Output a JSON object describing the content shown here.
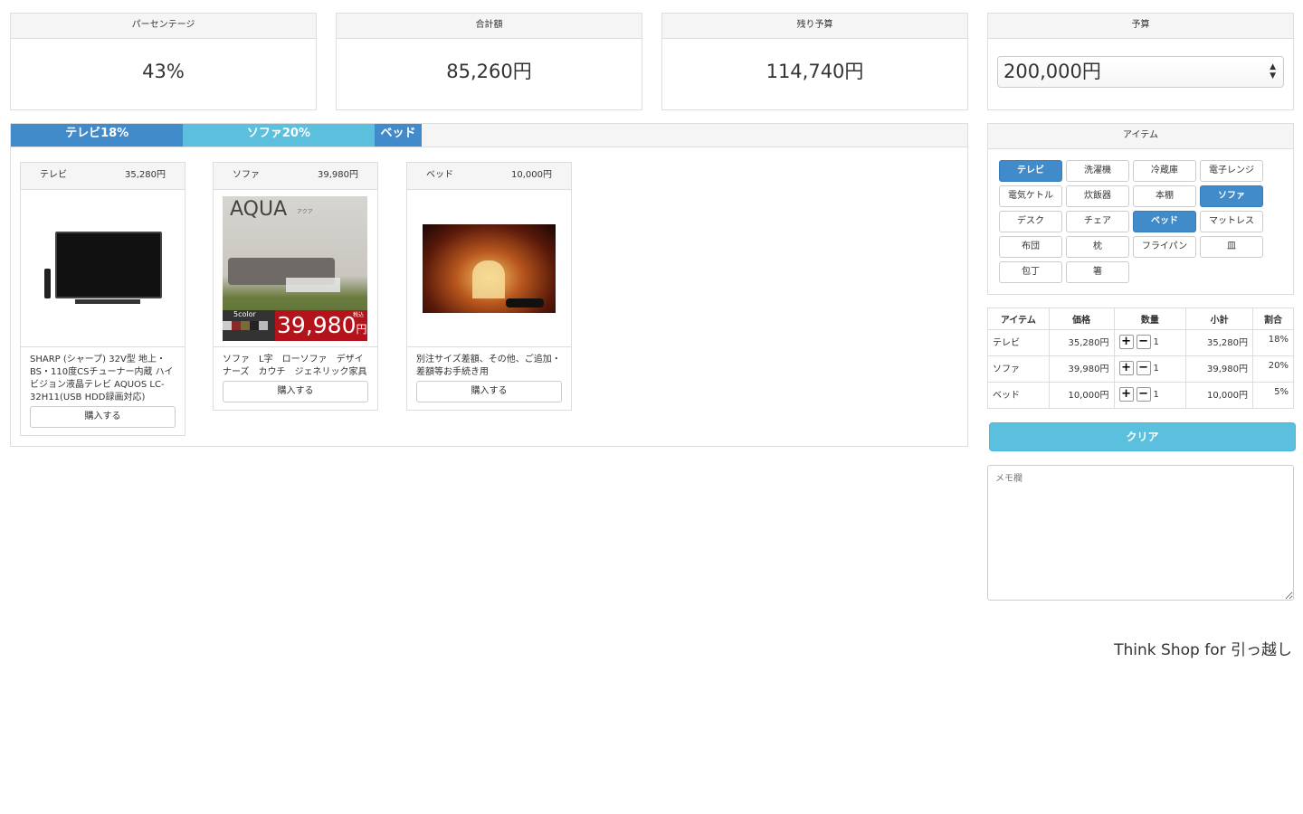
{
  "stats": [
    {
      "label": "パーセンテージ",
      "value": "43%"
    },
    {
      "label": "合計額",
      "value": "85,260円"
    },
    {
      "label": "残り予算",
      "value": "114,740円"
    }
  ],
  "budget": {
    "label": "予算",
    "value": "200,000円"
  },
  "progress": [
    {
      "label": "テレビ18%",
      "percent": 18,
      "color": "#428bca"
    },
    {
      "label": "ソファ20%",
      "percent": 20,
      "color": "#5bc0de"
    },
    {
      "label": "ベッド",
      "percent": 5,
      "color": "#428bca"
    }
  ],
  "cards": [
    {
      "name": "テレビ",
      "price": "35,280円",
      "desc": "SHARP (シャープ) 32V型 地上・BS・110度CSチューナー内蔵 ハイビジョン液晶テレビ AQUOS LC-32H11(USB HDD録画対応)",
      "buy": "購入する"
    },
    {
      "name": "ソファ",
      "price": "39,980円",
      "desc": "ソファ　L字　ローソファ　デザイナーズ　カウチ　ジェネリック家具",
      "buy": "購入する",
      "img_title": "AQUA",
      "img_sub": "アクア",
      "img_color": "5color",
      "img_price": "39,980",
      "img_yen": "円",
      "img_tax": "税込"
    },
    {
      "name": "ベッド",
      "price": "10,000円",
      "desc": "別注サイズ差額、その他、ご追加・差額等お手続き用",
      "buy": "購入する"
    }
  ],
  "items_panel": {
    "title": "アイテム",
    "items": [
      {
        "label": "テレビ",
        "on": true
      },
      {
        "label": "洗濯機",
        "on": false
      },
      {
        "label": "冷蔵庫",
        "on": false
      },
      {
        "label": "電子レンジ",
        "on": false
      },
      {
        "label": "電気ケトル",
        "on": false
      },
      {
        "label": "炊飯器",
        "on": false
      },
      {
        "label": "本棚",
        "on": false
      },
      {
        "label": "ソファ",
        "on": true
      },
      {
        "label": "デスク",
        "on": false
      },
      {
        "label": "チェア",
        "on": false
      },
      {
        "label": "ベッド",
        "on": true
      },
      {
        "label": "マットレス",
        "on": false
      },
      {
        "label": "布団",
        "on": false
      },
      {
        "label": "枕",
        "on": false
      },
      {
        "label": "フライパン",
        "on": false
      },
      {
        "label": "皿",
        "on": false
      },
      {
        "label": "包丁",
        "on": false
      },
      {
        "label": "箸",
        "on": false
      }
    ]
  },
  "table": {
    "headers": [
      "アイテム",
      "価格",
      "数量",
      "小計",
      "割合"
    ],
    "rows": [
      {
        "item": "テレビ",
        "price": "35,280円",
        "qty": "1",
        "subtotal": "35,280円",
        "ratio": "18%"
      },
      {
        "item": "ソファ",
        "price": "39,980円",
        "qty": "1",
        "subtotal": "39,980円",
        "ratio": "20%"
      },
      {
        "item": "ベッド",
        "price": "10,000円",
        "qty": "1",
        "subtotal": "10,000円",
        "ratio": "5%"
      }
    ]
  },
  "clear_label": "クリア",
  "memo_placeholder": "メモ欄",
  "footer": "Think Shop for 引っ越し"
}
